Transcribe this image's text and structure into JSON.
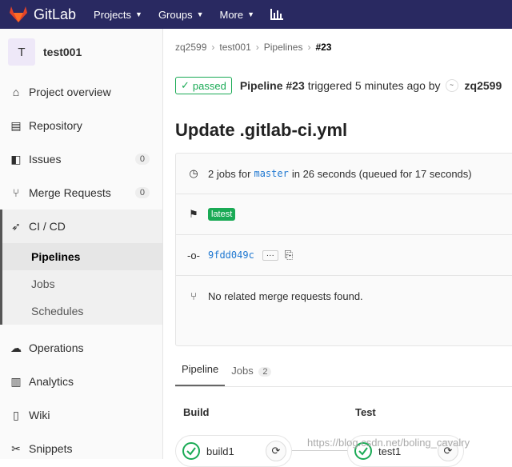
{
  "topbar": {
    "brand": "GitLab",
    "nav": [
      "Projects",
      "Groups",
      "More"
    ]
  },
  "sidebar": {
    "project_initial": "T",
    "project_name": "test001",
    "items": [
      {
        "label": "Project overview",
        "icon": "house-icon"
      },
      {
        "label": "Repository",
        "icon": "book-icon"
      },
      {
        "label": "Issues",
        "icon": "issues-icon",
        "badge": "0"
      },
      {
        "label": "Merge Requests",
        "icon": "merge-request-icon",
        "badge": "0"
      },
      {
        "label": "CI / CD",
        "icon": "rocket-icon"
      }
    ],
    "ci_sub": [
      "Pipelines",
      "Jobs",
      "Schedules"
    ],
    "bottom_items": [
      {
        "label": "Operations",
        "icon": "cloud-gear-icon"
      },
      {
        "label": "Analytics",
        "icon": "chart-icon"
      },
      {
        "label": "Wiki",
        "icon": "book-icon"
      },
      {
        "label": "Snippets",
        "icon": "snippet-icon"
      }
    ]
  },
  "breadcrumb": [
    "zq2599",
    "test001",
    "Pipelines",
    "#23"
  ],
  "header": {
    "status": "passed",
    "pipeline": "Pipeline #23",
    "triggered": "triggered 5 minutes ago by",
    "user": "zq2599"
  },
  "title": "Update .gitlab-ci.yml",
  "info": {
    "jobs_prefix": "2 jobs for",
    "branch": "master",
    "duration": "in 26 seconds (queued for 17 seconds)",
    "tag": "latest",
    "commit": "9fdd049c",
    "mr": "No related merge requests found."
  },
  "tabs": [
    {
      "label": "Pipeline"
    },
    {
      "label": "Jobs",
      "count": "2"
    }
  ],
  "stages": [
    {
      "name": "Build",
      "job": "build1"
    },
    {
      "name": "Test",
      "job": "test1"
    }
  ],
  "watermark": "https://blog.csdn.net/boling_cavalry",
  "colors": {
    "topbar": "#292961",
    "success": "#1aaa55",
    "link": "#1f78d1"
  }
}
